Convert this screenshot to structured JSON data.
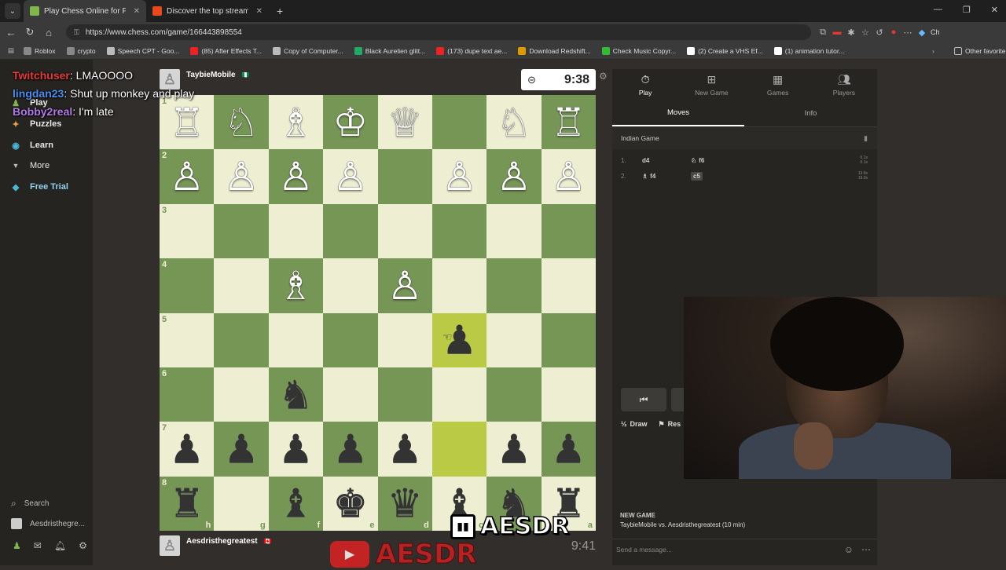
{
  "browser": {
    "tabs": [
      {
        "title": "Play Chess Online for FREE - 2 Pla",
        "fav_color": "#81b64c",
        "active": true
      },
      {
        "title": "Discover the top streamed music a",
        "fav_color": "#e8481c",
        "active": false
      }
    ],
    "url": "https://www.chess.com/game/166443898554",
    "bookmarks": [
      {
        "label": "Roblox",
        "icon_color": "#888"
      },
      {
        "label": "crypto",
        "icon_color": "#888"
      },
      {
        "label": "Speech CPT - Goo...",
        "icon_color": "#bbb"
      },
      {
        "label": "(85) After Effects T...",
        "icon_color": "#e22"
      },
      {
        "label": "Copy of Computer...",
        "icon_color": "#bbb"
      },
      {
        "label": "Black Aurelien glitt...",
        "icon_color": "#2a6"
      },
      {
        "label": "(173) dupe text ae...",
        "icon_color": "#e22"
      },
      {
        "label": "Download Redshift...",
        "icon_color": "#d90"
      },
      {
        "label": "Check Music Copyr...",
        "icon_color": "#3b3"
      },
      {
        "label": "(2) Create a VHS Ef...",
        "icon_color": "#fff"
      },
      {
        "label": "(1) animation tutor...",
        "icon_color": "#fff"
      }
    ],
    "other_favorites": "Other favorite",
    "profile_label": "Ch"
  },
  "leftnav": {
    "items": [
      {
        "label": "Play",
        "icon": "pawn-icon",
        "color": "#81b64c"
      },
      {
        "label": "Puzzles",
        "icon": "puzzle-icon",
        "color": "#f1a23c"
      },
      {
        "label": "Learn",
        "icon": "learn-icon",
        "color": "#4ab7d8"
      },
      {
        "label": "More",
        "icon": "chevron-down-icon",
        "color": "#bbb"
      },
      {
        "label": "Free Trial",
        "icon": "diamond-icon",
        "color": "#4ab7d8"
      }
    ],
    "search": "Search",
    "username": "Aesdristhegre..."
  },
  "chat": [
    {
      "user": "Twitchuser",
      "user_color": "#e83b3b",
      "text": ": LMAOOOO"
    },
    {
      "user": "lingdan23",
      "user_color": "#4a8ef0",
      "text": ": Shut up monkey and play"
    },
    {
      "user": "Bobby2real",
      "user_color": "#b07be8",
      "text": ": I'm late"
    }
  ],
  "game": {
    "top_player": {
      "name": "TaybieMobile",
      "flag": "🇳🇬",
      "clock": "9:38"
    },
    "bottom_player": {
      "name": "Aesdristhegreatest",
      "flag": "🇨🇦",
      "clock": "9:41"
    },
    "orientation": "white-top",
    "board": [
      [
        "wR",
        "wN",
        "wB",
        "wK",
        "wQ",
        "",
        "wN",
        "wR"
      ],
      [
        "wP",
        "wP",
        "wP",
        "wP",
        "",
        "wP",
        "wP",
        "wP"
      ],
      [
        "",
        "",
        "",
        "",
        "",
        "",
        "",
        ""
      ],
      [
        "",
        "",
        "wB",
        "",
        "wP",
        "",
        "",
        ""
      ],
      [
        "",
        "",
        "",
        "",
        "",
        "bP",
        "",
        ""
      ],
      [
        "",
        "",
        "bN",
        "",
        "",
        "",
        "",
        ""
      ],
      [
        "bP",
        "bP",
        "bP",
        "bP",
        "bP",
        "",
        "bP",
        "bP"
      ],
      [
        "bR",
        "",
        "bB",
        "bK",
        "bQ",
        "bB",
        "bN",
        "bR"
      ]
    ],
    "ranks": [
      "1",
      "2",
      "3",
      "4",
      "5",
      "6",
      "7",
      "8"
    ],
    "files": [
      "h",
      "g",
      "f",
      "e",
      "d",
      "c",
      "b",
      "a"
    ],
    "highlight": [
      [
        4,
        5
      ],
      [
        6,
        5
      ]
    ]
  },
  "panel": {
    "tabs": [
      {
        "label": "Play",
        "icon": "stopwatch-icon"
      },
      {
        "label": "New Game",
        "icon": "plus-icon"
      },
      {
        "label": "Games",
        "icon": "board-icon"
      },
      {
        "label": "Players",
        "icon": "players-icon"
      }
    ],
    "subtabs": [
      "Moves",
      "Info"
    ],
    "opening": "Indian Game",
    "moves": [
      {
        "num": "1.",
        "white": "d4",
        "black": "f6",
        "black_piece": "♘",
        "white_time": "0.1s",
        "black_time": "0.1s"
      },
      {
        "num": "2.",
        "white": "f4",
        "white_piece": "♗",
        "black": "c5",
        "white_time": "13.6s",
        "black_time": "19.0s"
      }
    ],
    "draw": "Draw",
    "resign": "Res",
    "newgame_title": "NEW GAME",
    "newgame_text": "TaybieMobile vs. Aesdristhegreatest (10 min)",
    "send_placeholder": "Send a message..."
  },
  "overlays": {
    "twitch_name": "AESDR",
    "youtube_name": "AESDR"
  }
}
